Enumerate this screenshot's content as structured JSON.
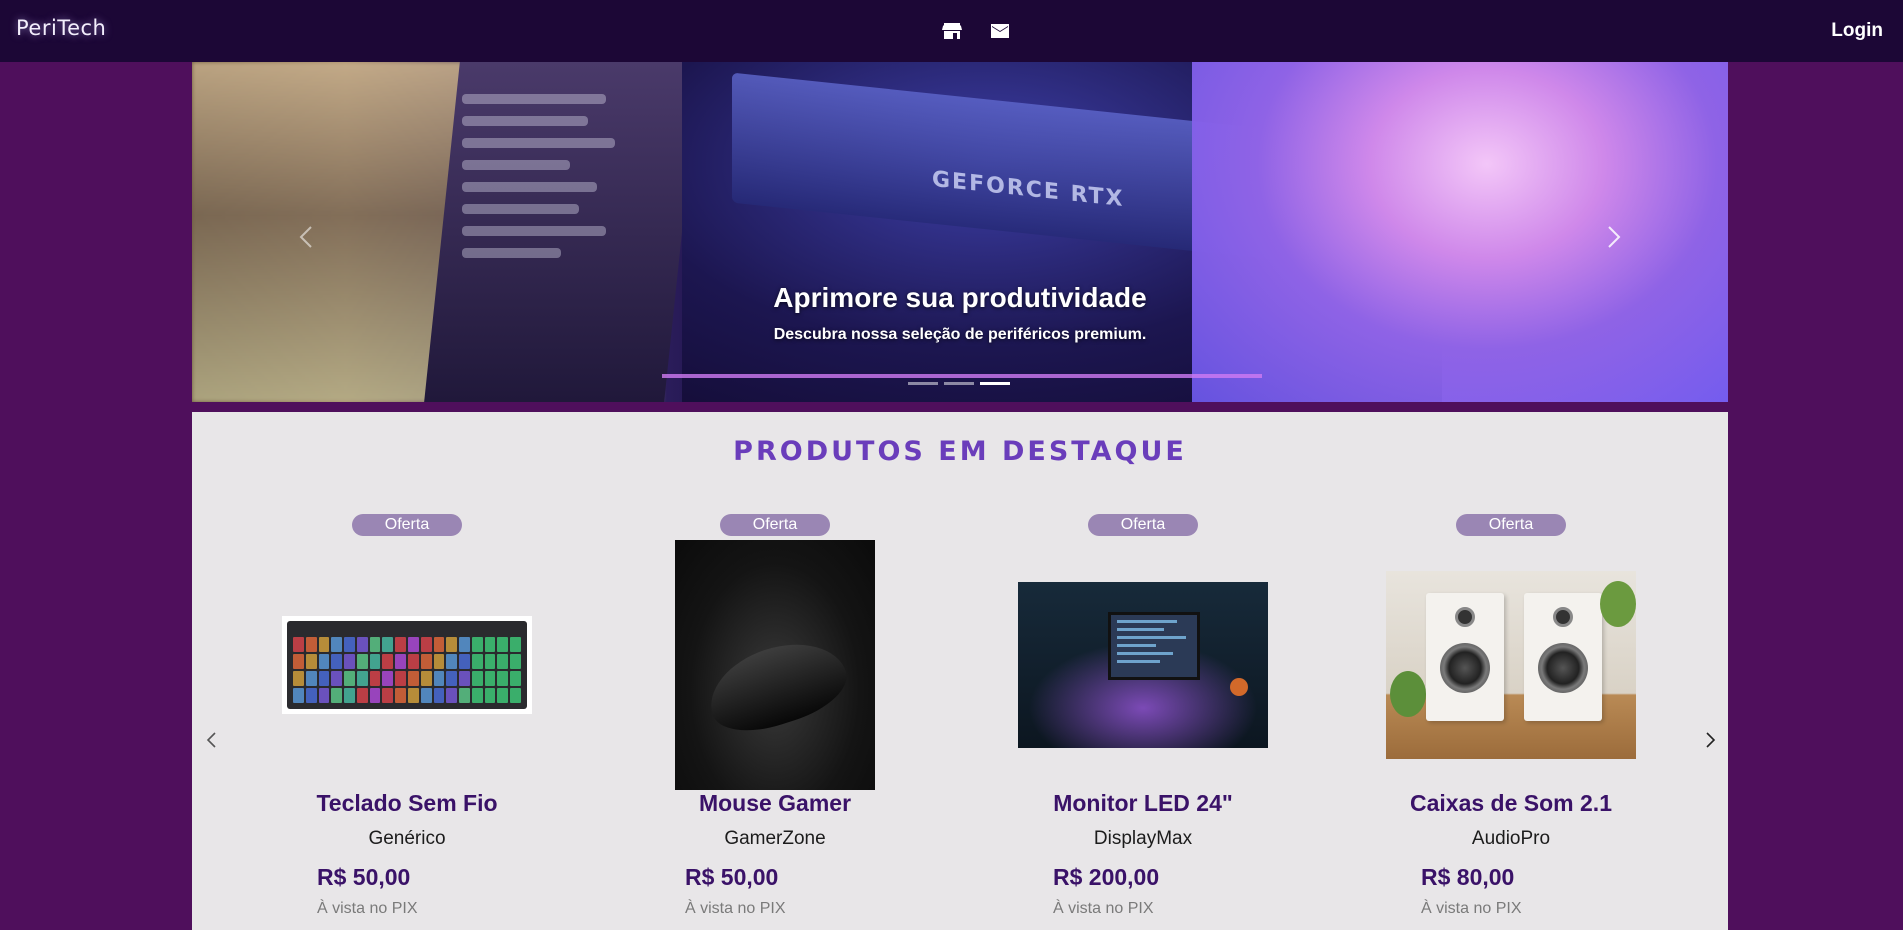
{
  "navbar": {
    "brand": "PeriTech",
    "icons": [
      "store-icon",
      "mail-icon"
    ],
    "login_label": "Login"
  },
  "hero": {
    "title": "Aprimore sua produtividade",
    "subtitle": "Descubra nossa seleção de periféricos premium.",
    "image_text": "GEFORCE RTX",
    "slide_count": 3,
    "active_slide": 3
  },
  "featured": {
    "title": "PRODUTOS EM DESTAQUE",
    "products": [
      {
        "badge": "Oferta",
        "name": "Teclado Sem Fio",
        "brand": "Genérico",
        "price": "R$ 50,00",
        "payment": "À vista no PIX",
        "image": "keyboard"
      },
      {
        "badge": "Oferta",
        "name": "Mouse Gamer",
        "brand": "GamerZone",
        "price": "R$ 50,00",
        "payment": "À vista no PIX",
        "image": "mouse"
      },
      {
        "badge": "Oferta",
        "name": "Monitor LED 24\"",
        "brand": "DisplayMax",
        "price": "R$ 200,00",
        "payment": "À vista no PIX",
        "image": "monitor"
      },
      {
        "badge": "Oferta",
        "name": "Caixas de Som 2.1",
        "brand": "AudioPro",
        "price": "R$ 80,00",
        "payment": "À vista no PIX",
        "image": "speakers"
      }
    ]
  },
  "colors": {
    "page_bg": "#4f0f5c",
    "navbar_bg": "#1c0736",
    "section_bg": "#e8e6e8",
    "accent_title": "#6a3dbb",
    "product_text": "#3a1268",
    "badge_bg": "#9a86b4"
  }
}
